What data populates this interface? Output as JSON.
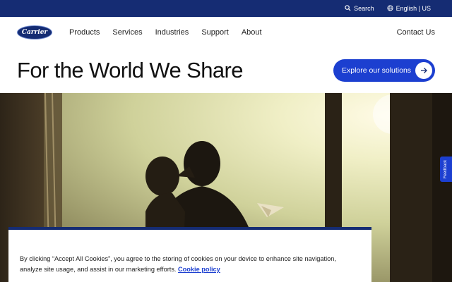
{
  "utility": {
    "search_label": "Search",
    "language_label": "English | US"
  },
  "nav": {
    "logo_text": "Carrier",
    "links": [
      "Products",
      "Services",
      "Industries",
      "Support",
      "About"
    ],
    "contact_label": "Contact Us"
  },
  "hero": {
    "title": "For the World We Share",
    "cta_label": "Explore our solutions"
  },
  "feedback_label": "Feedback",
  "cookie": {
    "message": "By clicking “Accept All Cookies”, you agree to the storing of cookies on your device to enhance site navigation, analyze site usage, and assist in our marketing efforts.",
    "link_label": "Cookie policy"
  },
  "colors": {
    "brand_navy": "#152c73",
    "accent_blue": "#1c3fd0"
  }
}
